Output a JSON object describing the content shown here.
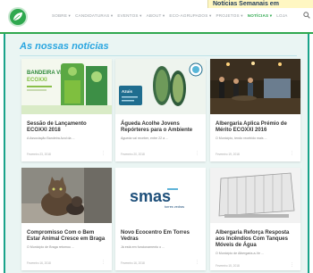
{
  "header": {
    "nav": [
      "SOBRE ▾",
      "CANDIDATURAS ▾",
      "EVENTOS ▾",
      "ABOUT ▾",
      "ECO-AGRUPADOS ▾",
      "PROJETOS ▾",
      "NOTÍCIAS ▾",
      "LOJA"
    ],
    "active_nav_index": 6,
    "ticker": "Notícias Semanais em"
  },
  "main": {
    "section_title": "As nossas notícias",
    "cards": [
      {
        "title": "Sessão de Lançamento ECOXXI 2018",
        "excerpt": "A Associação Bandeira Azul da ...",
        "date": "Fevereiro 23, 2018",
        "thumb": "poster-ecoxxi"
      },
      {
        "title": "Águeda Acolhe Jovens Repórteres para o Ambiente",
        "excerpt": "Águeda vai receber, entre 22 a ...",
        "date": "Fevereiro 20, 2018",
        "thumb": "poster-jra"
      },
      {
        "title": "Albergaria Aplica Prémio de Mérito ECOXXI 2016",
        "excerpt": "O Município, tendo recebido mais ...",
        "date": "Fevereiro 19, 2018",
        "thumb": "stage-photo"
      },
      {
        "title": "Compromisso Com o Bem Estar Animal Cresce em Braga",
        "excerpt": "O Município de Braga retomou ...",
        "date": "Fevereiro 16, 2018",
        "thumb": "cats-photo"
      },
      {
        "title": "Novo Ecocentro Em Torres Vedras",
        "excerpt": "Já está em funcionamento o ...",
        "date": "Fevereiro 16, 2018",
        "thumb": "smas-logo"
      },
      {
        "title": "Albergaria Reforça Resposta aos Incêndios Com Tanques Móveis de Água",
        "excerpt": "O Município de Albergaria-a-Ve ...",
        "date": "Fevereiro 15, 2018",
        "thumb": "water-tanks"
      }
    ],
    "smas_logo_text": "smas",
    "smas_logo_sub": "torres vedras",
    "poster1_heading": "BANDEIRA VERDE",
    "poster1_brand": "ECOXXI",
    "poster2_brand": "Azuis"
  }
}
